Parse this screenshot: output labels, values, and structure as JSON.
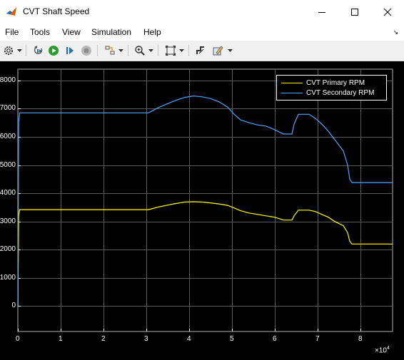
{
  "window": {
    "title": "CVT Shaft Speed"
  },
  "menu": {
    "items": [
      "File",
      "Tools",
      "View",
      "Simulation",
      "Help"
    ]
  },
  "toolbar": {
    "buttons": [
      {
        "name": "settings-icon"
      },
      {
        "name": "step-back-icon"
      },
      {
        "name": "run-icon"
      },
      {
        "name": "step-forward-icon"
      },
      {
        "name": "stop-icon"
      },
      {
        "name": "signal-highlight-icon"
      },
      {
        "name": "zoom-icon"
      },
      {
        "name": "fit-to-view-icon"
      },
      {
        "name": "cursor-measure-icon"
      },
      {
        "name": "edit-style-icon"
      }
    ]
  },
  "chart_data": {
    "type": "line",
    "title": "",
    "xlabel": "",
    "ylabel": "",
    "x_exponent_label": "×10",
    "x_exponent_sup": "4",
    "xlim": [
      0,
      87500
    ],
    "ylim": [
      -900,
      8400
    ],
    "x_ticks": [
      0,
      10000,
      20000,
      30000,
      40000,
      50000,
      60000,
      70000,
      80000
    ],
    "x_tick_labels": [
      "0",
      "1",
      "2",
      "3",
      "4",
      "5",
      "6",
      "7",
      "8"
    ],
    "y_ticks": [
      0,
      1000,
      2000,
      3000,
      4000,
      5000,
      6000,
      7000,
      8000
    ],
    "y_tick_labels": [
      "0",
      "1000",
      "2000",
      "3000",
      "4000",
      "5000",
      "6000",
      "7000",
      "8000"
    ],
    "grid": true,
    "legend_position": "top-right",
    "series": [
      {
        "name": "CVT Primary RPM",
        "color": "#ffff00",
        "x": [
          0,
          200,
          400,
          30500,
          31500,
          33000,
          35000,
          37000,
          39000,
          41000,
          43000,
          45000,
          47000,
          49000,
          50500,
          52000,
          54000,
          56000,
          58000,
          60000,
          62000,
          64000,
          64500,
          65500,
          68000,
          69500,
          71000,
          72500,
          74000,
          76000,
          77000,
          77500,
          78000,
          87500
        ],
        "y": [
          0,
          3200,
          3420,
          3420,
          3460,
          3520,
          3580,
          3640,
          3690,
          3700,
          3690,
          3660,
          3620,
          3570,
          3480,
          3380,
          3300,
          3250,
          3200,
          3150,
          3050,
          3050,
          3200,
          3400,
          3400,
          3350,
          3250,
          3150,
          3000,
          2850,
          2600,
          2300,
          2200,
          2200
        ]
      },
      {
        "name": "CVT Secondary RPM",
        "color": "#4da6ff",
        "x": [
          0,
          200,
          400,
          30500,
          31500,
          33000,
          35000,
          37000,
          39000,
          41000,
          43000,
          45000,
          47000,
          49000,
          50500,
          52000,
          54000,
          56000,
          58000,
          60000,
          62000,
          64000,
          64500,
          65500,
          68000,
          69500,
          71000,
          72500,
          74000,
          76000,
          77000,
          77500,
          78000,
          87500
        ],
        "y": [
          0,
          6500,
          6850,
          6850,
          6930,
          7050,
          7180,
          7300,
          7400,
          7450,
          7420,
          7360,
          7240,
          7050,
          6800,
          6600,
          6500,
          6420,
          6380,
          6250,
          6100,
          6100,
          6450,
          6800,
          6800,
          6650,
          6450,
          6200,
          5900,
          5500,
          5000,
          4500,
          4380,
          4380
        ]
      }
    ]
  }
}
